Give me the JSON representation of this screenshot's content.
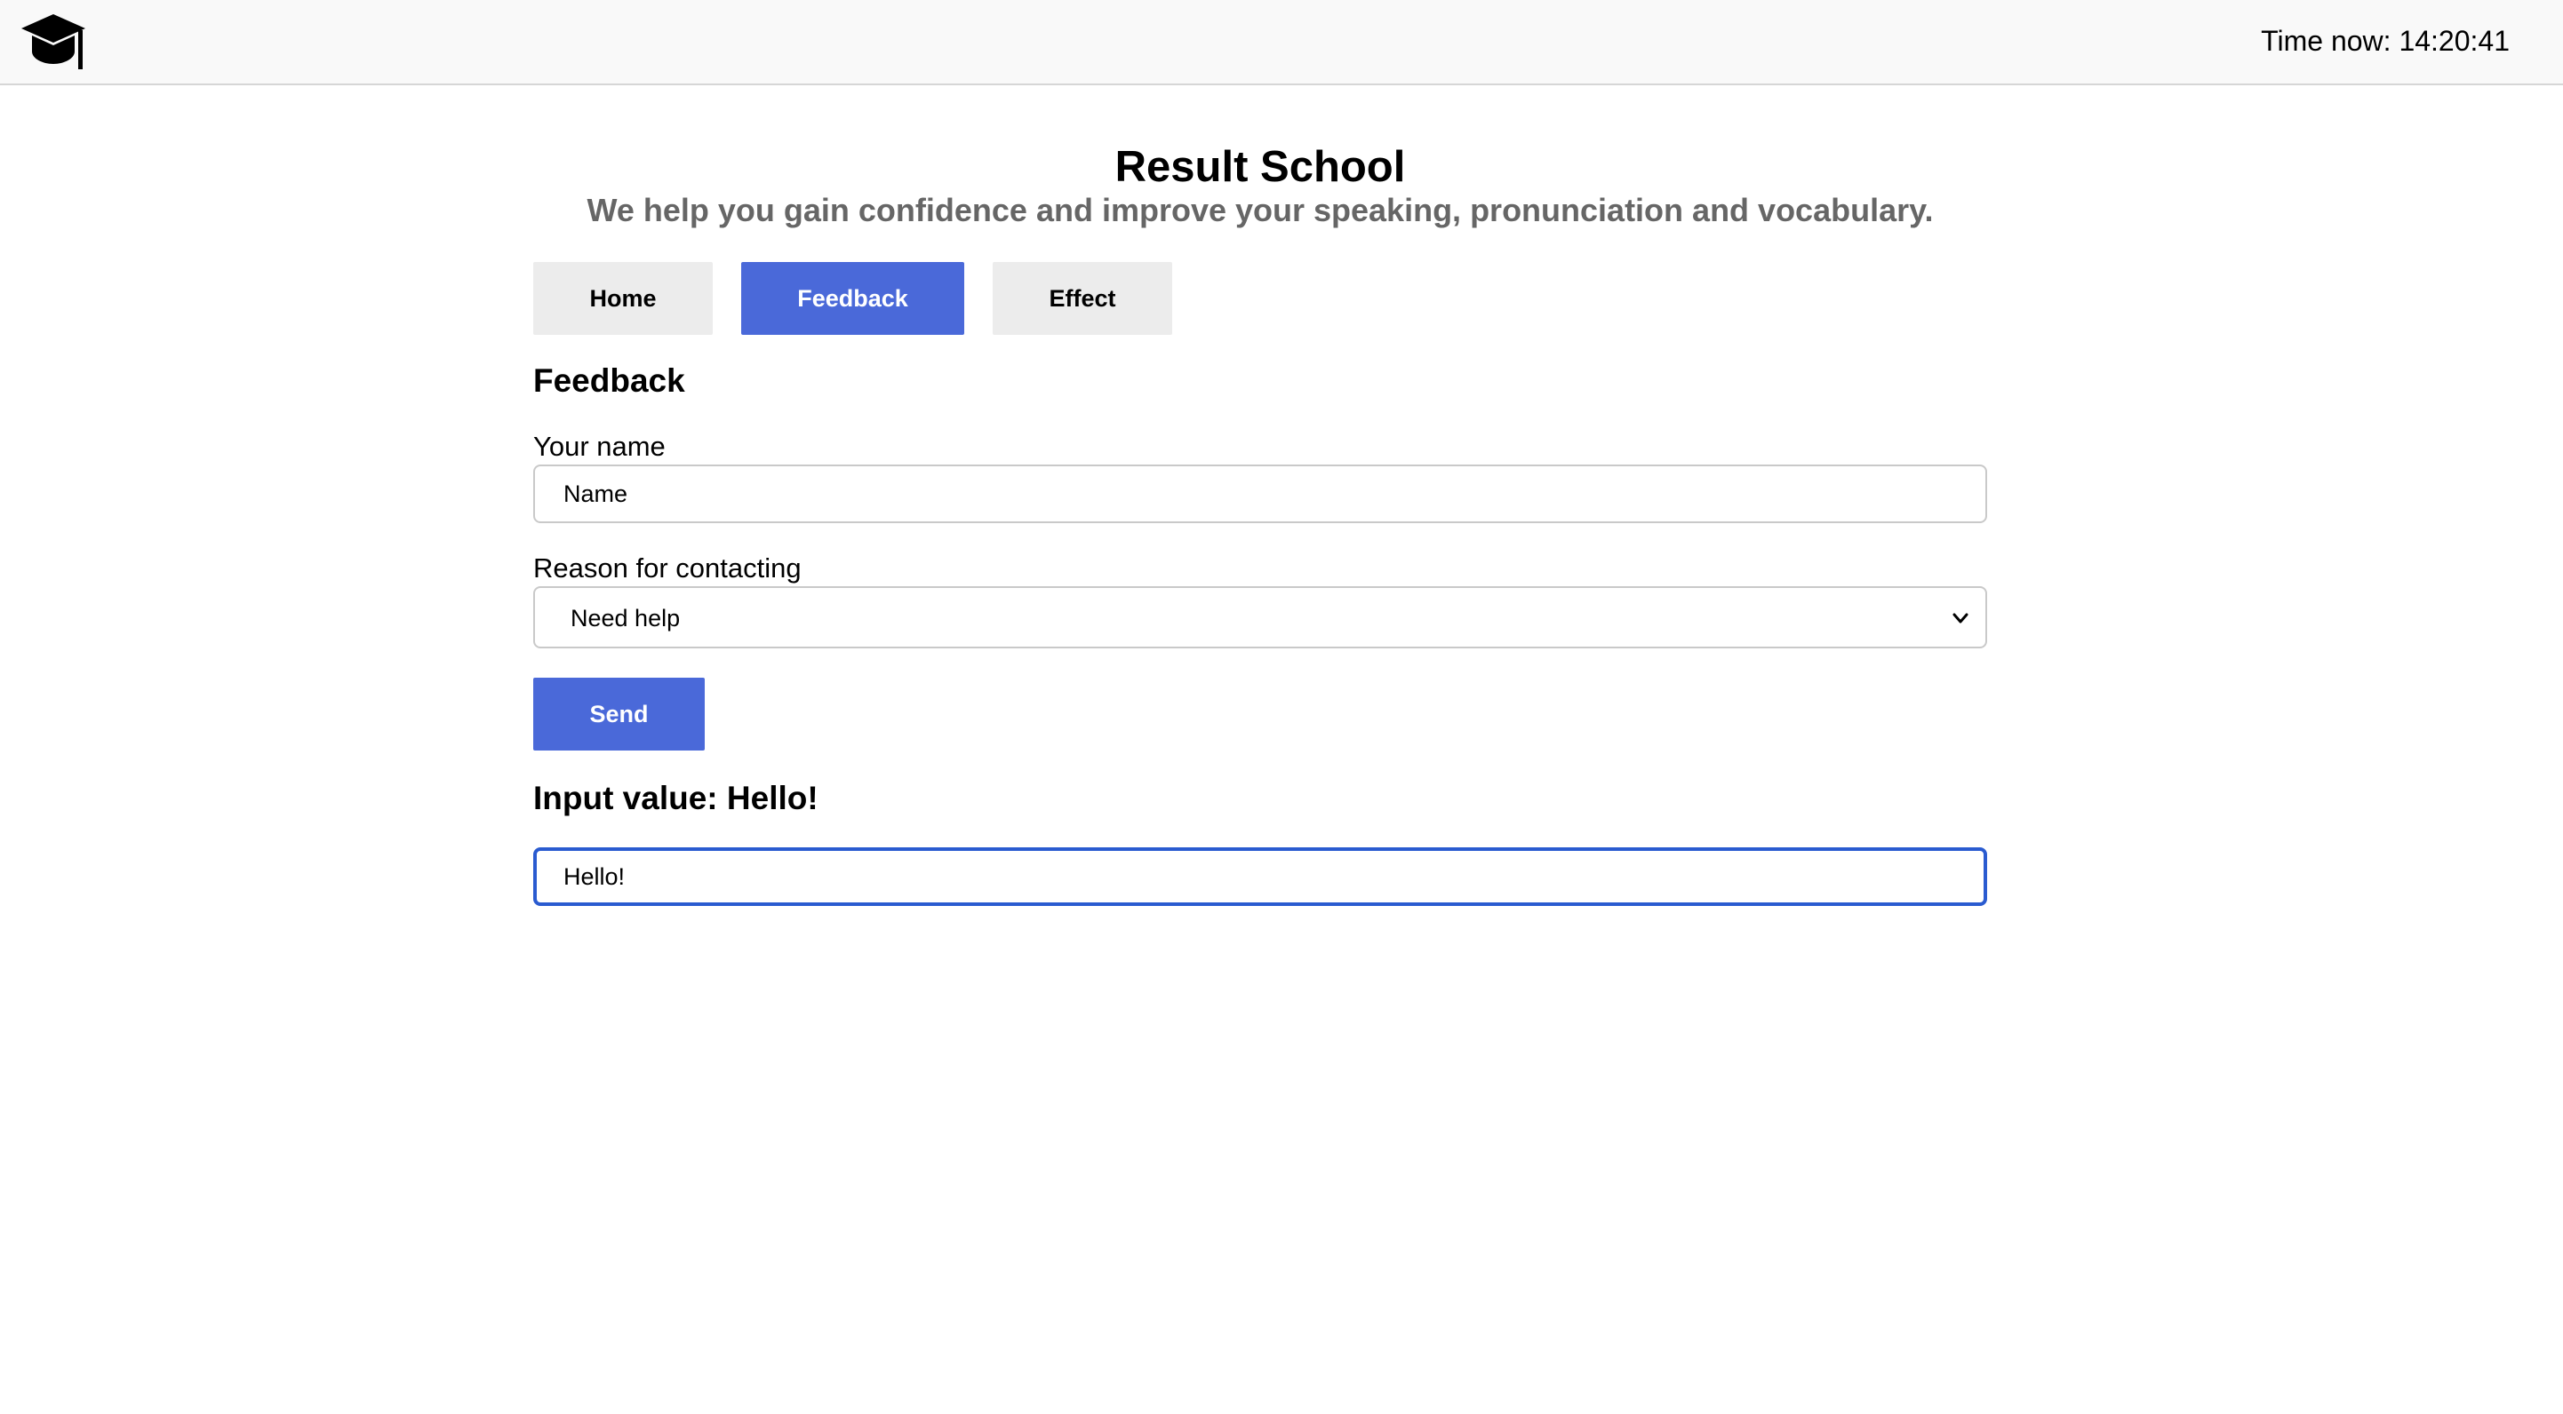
{
  "header": {
    "logo_icon": "graduation-cap-icon",
    "clock_text": "Time now: 14:20:41"
  },
  "hero": {
    "title": "Result School",
    "subtitle": "We help you gain confidence and improve your speaking, pronunciation and vocabulary."
  },
  "nav": {
    "tabs": [
      {
        "label": "Home",
        "active": false
      },
      {
        "label": "Feedback",
        "active": true
      },
      {
        "label": "Effect",
        "active": false
      }
    ]
  },
  "feedback": {
    "heading": "Feedback",
    "name_label": "Your name",
    "name_placeholder": "Name",
    "name_value": "",
    "reason_label": "Reason for contacting",
    "reason_selected": "Need help",
    "reason_icon": "chevron-down-icon",
    "send_label": "Send",
    "input_value_heading": "Input value: Hello!",
    "input_value": "Hello!"
  },
  "colors": {
    "accent": "#4a69d9",
    "focus_border": "#2a5bd0",
    "subtitle": "#666666",
    "inactive_button": "#ececec"
  }
}
